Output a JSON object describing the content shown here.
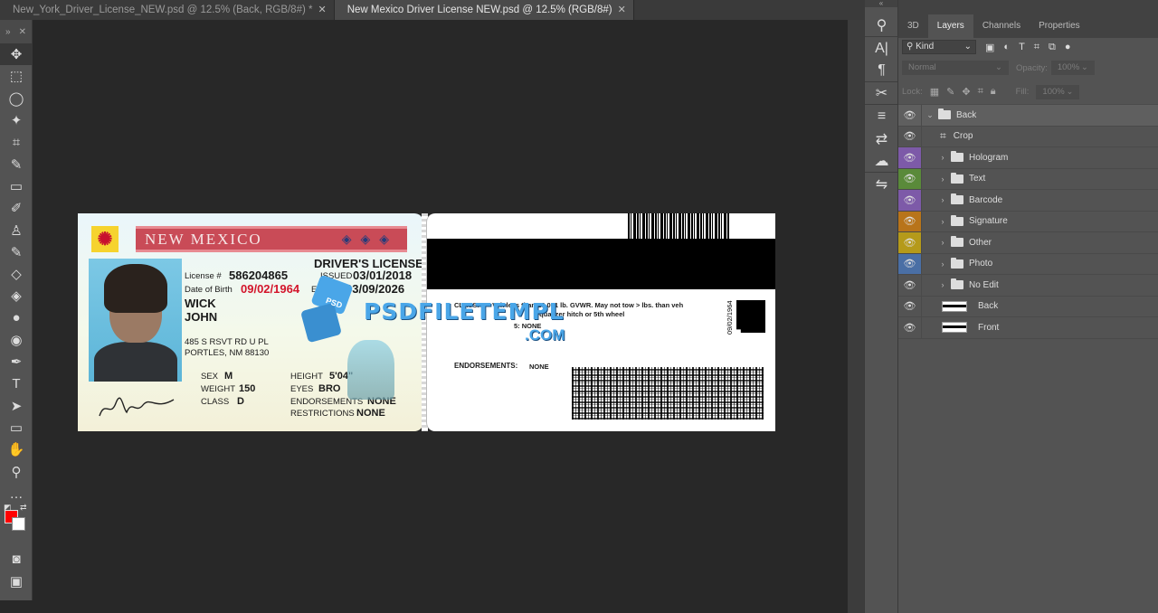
{
  "tabs": [
    {
      "label": "New_York_Driver_License_NEW.psd @ 12.5% (Back, RGB/8#) *",
      "active": false
    },
    {
      "label": "New Mexico Driver License NEW.psd @ 12.5% (RGB/8#)",
      "active": true
    }
  ],
  "tab_close": "✕",
  "toolbar": {
    "tools": [
      {
        "name": "move-tool",
        "glyph": "✥"
      },
      {
        "name": "marquee-tool",
        "glyph": "⬚"
      },
      {
        "name": "lasso-tool",
        "glyph": "◯"
      },
      {
        "name": "magic-wand-tool",
        "glyph": "✦"
      },
      {
        "name": "crop-tool",
        "glyph": "⌗"
      },
      {
        "name": "eyedropper-tool",
        "glyph": "✎"
      },
      {
        "name": "healing-brush-tool",
        "glyph": "▭"
      },
      {
        "name": "brush-tool",
        "glyph": "✐"
      },
      {
        "name": "clone-stamp-tool",
        "glyph": "♙"
      },
      {
        "name": "history-brush-tool",
        "glyph": "✎"
      },
      {
        "name": "eraser-tool",
        "glyph": "◇"
      },
      {
        "name": "paint-bucket-tool",
        "glyph": "◈"
      },
      {
        "name": "blur-tool",
        "glyph": "●"
      },
      {
        "name": "dodge-tool",
        "glyph": "◉"
      },
      {
        "name": "pen-tool",
        "glyph": "✒"
      },
      {
        "name": "type-tool",
        "glyph": "T"
      },
      {
        "name": "path-selection-tool",
        "glyph": "➤"
      },
      {
        "name": "rectangle-tool",
        "glyph": "▭"
      },
      {
        "name": "hand-tool",
        "glyph": "✋"
      },
      {
        "name": "zoom-tool",
        "glyph": "⚲"
      },
      {
        "name": "more-tools",
        "glyph": "…"
      }
    ],
    "foreground_color": "#ff0000",
    "background_color": "#ffffff",
    "quick_mask_glyph": "◙",
    "screen_mode_glyph": "▣"
  },
  "license_front": {
    "state": "NEW MEXICO",
    "doc_type": "DRIVER'S LICENSE",
    "license_label": "License #",
    "license_number": "586204865",
    "issued_label": "ISSUED",
    "issued": "03/01/2018",
    "dob_label": "Date of Birth",
    "dob": "09/02/1964",
    "exp_label": "EXP",
    "exp": "03/09/2026",
    "last_name": "WICK",
    "first_name": "JOHN",
    "address1": "485 S RSVT RD U PL",
    "address2": "PORTLES, NM 88130",
    "sex_label": "SEX",
    "sex": "M",
    "height_label": "HEIGHT",
    "height": "5'04\"",
    "weight_label": "WEIGHT",
    "weight": "150",
    "eyes_label": "EYES",
    "eyes": "BRO",
    "class_label": "CLASS",
    "class": "D",
    "endorsements_label": "ENDORSEMENTS",
    "endorsements": "NONE",
    "restrictions_label": "RESTRICTIONS",
    "restrictions": "NONE"
  },
  "watermark": {
    "text": "PSDFILETEMPL",
    "suffix": ".COM",
    "badge": "PSD"
  },
  "license_back": {
    "class_line1": "CLASS: D - Veh less than 26,001 lb. GVWR. May not tow > lbs. than veh",
    "class_line2": "equalizer hitch or 5th wheel",
    "restr_line": "5: NONE",
    "endorsements_label": "ENDORSEMENTS:",
    "endorsements": "NONE",
    "vertical_dob": "09/02/1964"
  },
  "panel_icons": [
    "⚲",
    "A|",
    "¶",
    "✂",
    "≡",
    "⇄",
    "☁",
    "⇋"
  ],
  "layers_panel": {
    "tabs": [
      "3D",
      "Layers",
      "Channels",
      "Properties"
    ],
    "active_tab": "Layers",
    "kind_label": "Kind",
    "blend_mode": "Normal",
    "opacity_label": "Opacity:",
    "opacity": "100%",
    "lock_label": "Lock:",
    "fill_label": "Fill:",
    "fill": "100%",
    "layers": [
      {
        "name": "Back",
        "type": "group-open",
        "color": "",
        "selected": true
      },
      {
        "name": "Crop",
        "type": "crop",
        "color": "",
        "selected": false
      },
      {
        "name": "Hologram",
        "type": "group",
        "color": "#7d5aa8",
        "selected": false
      },
      {
        "name": "Text",
        "type": "group",
        "color": "#5a8a3a",
        "selected": false
      },
      {
        "name": "Barcode",
        "type": "group",
        "color": "#7d5aa8",
        "selected": false
      },
      {
        "name": "Signature",
        "type": "group",
        "color": "#b8741a",
        "selected": false
      },
      {
        "name": "Other",
        "type": "group",
        "color": "#b59a1a",
        "selected": false
      },
      {
        "name": "Photo",
        "type": "group",
        "color": "#4a6fa5",
        "selected": false
      },
      {
        "name": "No Edit",
        "type": "group",
        "color": "",
        "selected": false
      },
      {
        "name": "Back",
        "type": "layer",
        "color": "",
        "selected": false
      },
      {
        "name": "Front",
        "type": "layer",
        "color": "",
        "selected": false
      }
    ]
  }
}
